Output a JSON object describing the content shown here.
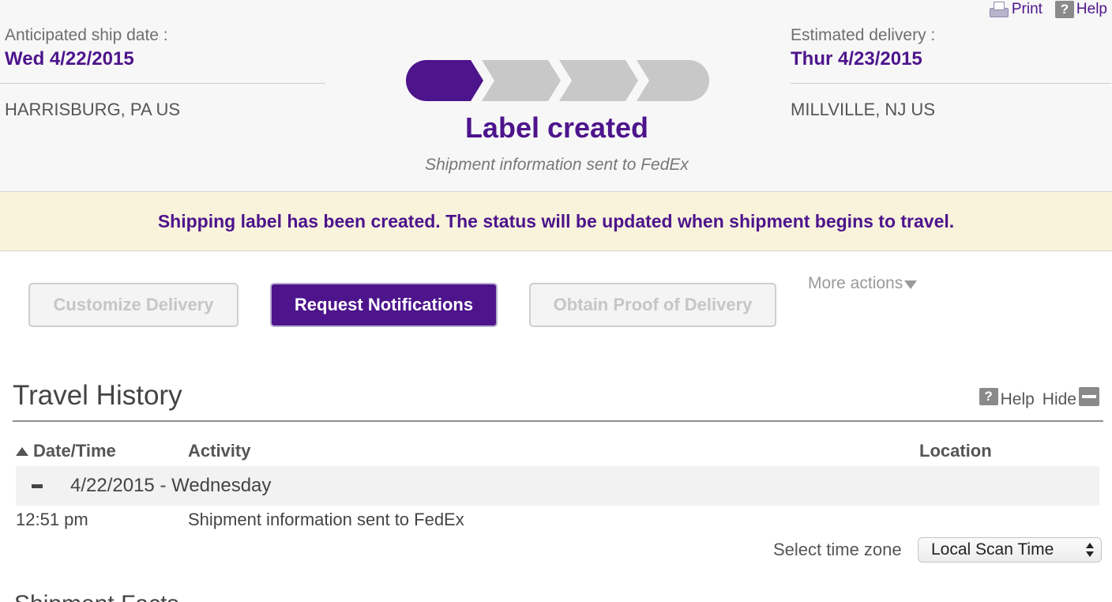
{
  "utility_links": {
    "print_label": "Print",
    "help_label": "Help"
  },
  "shipment": {
    "ship": {
      "label": "Anticipated ship date :",
      "date": "Wed 4/22/2015",
      "location": "HARRISBURG, PA US"
    },
    "delivery": {
      "label": "Estimated delivery :",
      "date": "Thur 4/23/2015",
      "location": "MILLVILLE, NJ US"
    },
    "status": {
      "title": "Label created",
      "subtitle": "Shipment information sent to FedEx",
      "progress_steps_total": 4,
      "progress_steps_complete": 1
    }
  },
  "banner": {
    "message": "Shipping label has been created. The status will be updated when shipment begins to travel."
  },
  "actions": {
    "customize_delivery": "Customize Delivery",
    "request_notifications": "Request Notifications",
    "obtain_proof": "Obtain Proof of Delivery",
    "more_actions": "More actions"
  },
  "travel_history": {
    "title": "Travel History",
    "help_label": "Help",
    "hide_label": "Hide",
    "columns": {
      "datetime": "Date/Time",
      "activity": "Activity",
      "location": "Location"
    },
    "groups": [
      {
        "date_label": "4/22/2015 - Wednesday",
        "events": [
          {
            "time": "12:51 pm",
            "activity": "Shipment information sent to FedEx",
            "location": ""
          }
        ]
      }
    ],
    "timezone": {
      "label": "Select time zone",
      "selected": "Local Scan Time"
    }
  },
  "next_section": {
    "title": "Shipment Facts"
  },
  "colors": {
    "brand_purple": "#4d148c",
    "progress_inactive": "#c8c8c8",
    "banner_background": "#faf3dc"
  }
}
